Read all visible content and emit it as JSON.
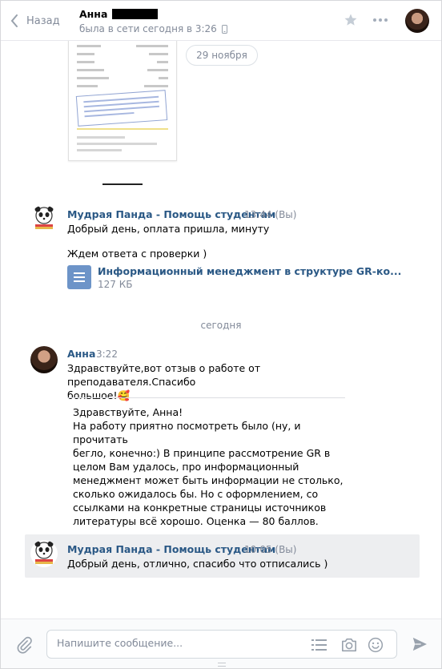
{
  "header": {
    "back_label": "Назад",
    "peer_name": "Анна",
    "peer_status": "была в сети сегодня в 3:26"
  },
  "history": {
    "date_pill": "29 ноября",
    "today_divider": "сегодня"
  },
  "messages": [
    {
      "author": "Мудрая Панда - Помощь студентам",
      "time": "13:44 (Вы)",
      "lines": [
        "Добрый день, оплата пришла, минуту",
        "Ждем ответа с проверки )"
      ],
      "attachment": {
        "title": "Информационный менеджмент в структуре GR-ко...",
        "size": "127 КБ"
      }
    },
    {
      "author": "Анна",
      "time": "3:22",
      "text_line1": "Здравствуйте,вот отзыв о работе от преподавателя.Спасибо",
      "text_line2": "большое!",
      "emoji": "🥰",
      "quote": "Здравствуйте, Анна!\nНа работу приятно посмотреть было (ну, и прочитать\nбегло, конечно:) В принципе рассмотрение GR в\nцелом Вам удалось, про информационный\nменеджмент может быть информации не столько,\nсколько ожидалось бы. Но с оформлением, со\nссылками на конкретные страницы источников\nлитературы всё хорошо. Оценка — 80 баллов."
    },
    {
      "author": "Мудрая Панда - Помощь студентам",
      "time": "10:05 (Вы)",
      "text": "Добрый день, отлично, спасибо что отписались )"
    }
  ],
  "composer": {
    "placeholder": "Напишите сообщение..."
  },
  "colors": {
    "link": "#2a5885",
    "muted": "#828a99",
    "doc_icon": "#6d94c8",
    "highlight": "#edeef0"
  }
}
